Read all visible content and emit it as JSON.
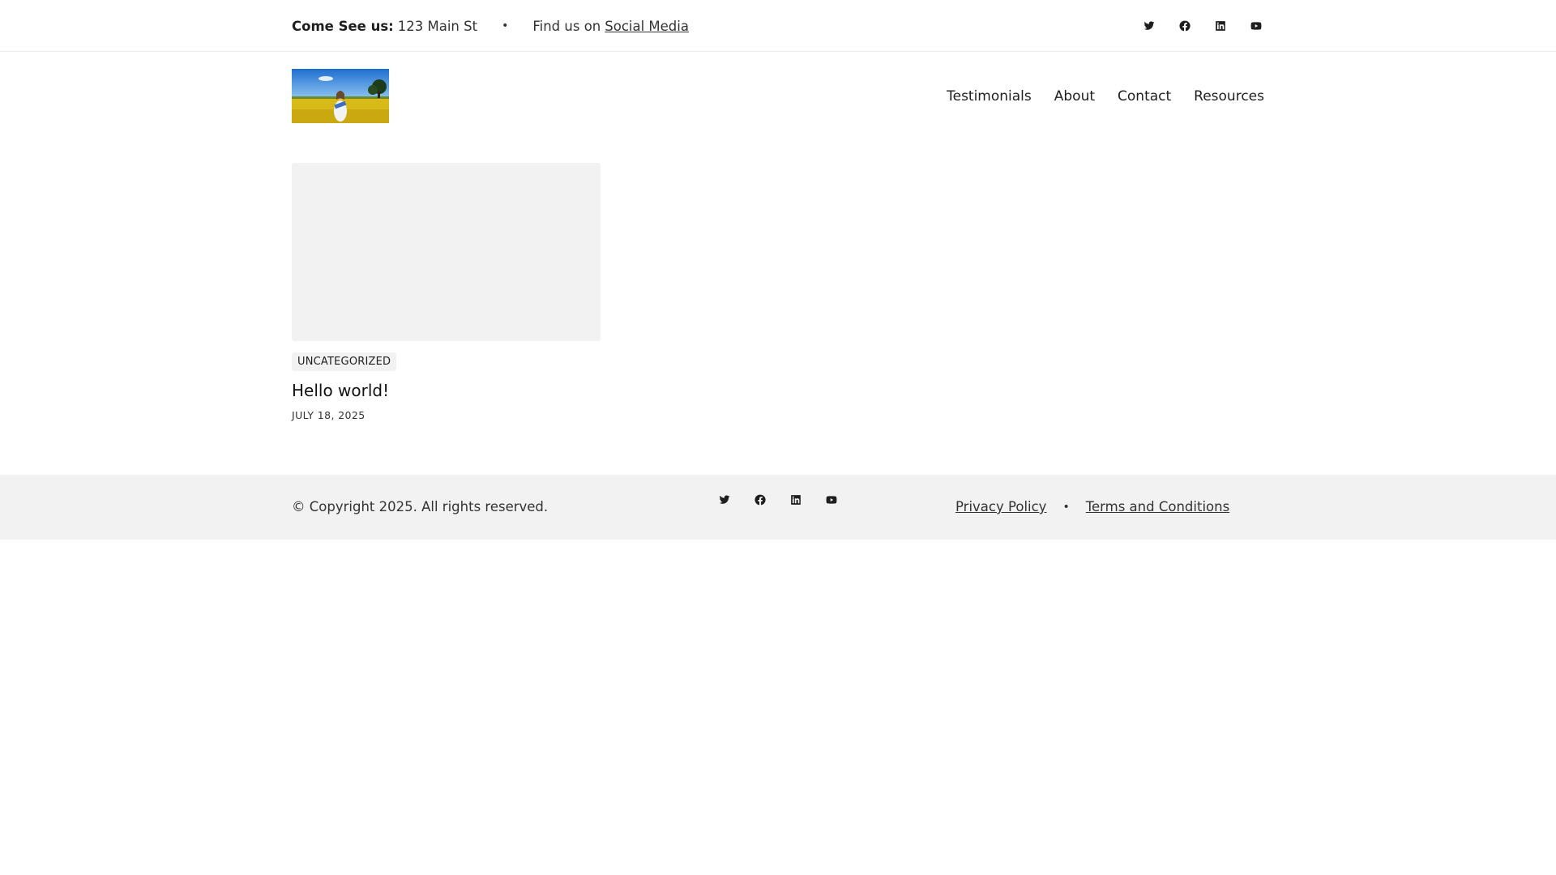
{
  "topbar": {
    "visit_label": "Come See us:",
    "address": "123 Main St",
    "separator": "•",
    "find_prefix": "Find us on",
    "social_link": "Social Media"
  },
  "social_icons": [
    "twitter-icon",
    "facebook-icon",
    "linkedin-icon",
    "youtube-icon"
  ],
  "header": {
    "nav": [
      "Testimonials",
      "About",
      "Contact",
      "Resources"
    ]
  },
  "post": {
    "category": "UNCATEGORIZED",
    "title": "Hello world!",
    "date": "JULY 18, 2025"
  },
  "footer": {
    "copyright": "© Copyright 2025. All rights reserved.",
    "links": [
      "Privacy Policy",
      "Terms and Conditions"
    ],
    "separator": "•"
  },
  "colors": {
    "text": "#1e1e1e",
    "muted_background": "#f2f2f2",
    "border": "#ececec"
  }
}
